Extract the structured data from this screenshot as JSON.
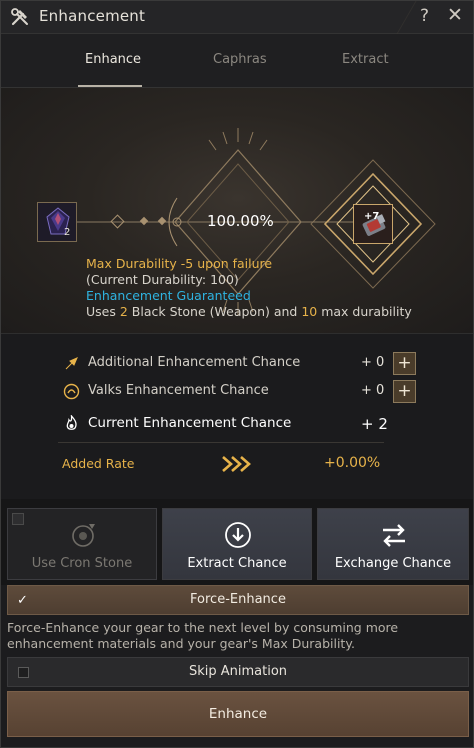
{
  "window": {
    "title": "Enhancement",
    "help": "?",
    "close": "✕"
  },
  "tabs": [
    {
      "label": "Enhance",
      "active": true
    },
    {
      "label": "Caphras",
      "active": false
    },
    {
      "label": "Extract",
      "active": false
    }
  ],
  "material": {
    "icon": "black-stone-icon",
    "count": "2"
  },
  "success_rate": "100.00%",
  "target": {
    "icon": "gear-item-icon",
    "enhance_level": "+7"
  },
  "info": {
    "line1": "Max Durability -5 upon failure",
    "line2": "(Current Durability: 100)",
    "line3": "Enhancement Guaranteed",
    "line4_prefix": "Uses ",
    "line4_num1": "2",
    "line4_mid": " Black Stone (Weapon) and ",
    "line4_num2": "10",
    "line4_suffix": " max durability"
  },
  "stats": {
    "additional": {
      "label": "Additional Enhancement Chance",
      "value": "+ 0",
      "add": "+"
    },
    "valks": {
      "label": "Valks Enhancement Chance",
      "value": "+ 0",
      "add": "+"
    },
    "current": {
      "label": "Current Enhancement Chance",
      "value": "+ 2"
    },
    "added_rate": {
      "label": "Added Rate",
      "value": "+0.00%"
    }
  },
  "actions": {
    "cron": "Use Cron Stone",
    "extract": "Extract Chance",
    "exchange": "Exchange Chance"
  },
  "force_enhance": {
    "label": "Force-Enhance",
    "checked": true,
    "check_glyph": "✓",
    "description": "Force-Enhance your gear to the next level by consuming more enhancement materials and your gear's Max Durability."
  },
  "skip_animation": {
    "label": "Skip Animation",
    "checked": false
  },
  "enhance_button": "Enhance",
  "colors": {
    "accent_gold": "#e7b34a",
    "guaranteed_blue": "#2fb3e0",
    "button_brown": "#5e4b3b"
  }
}
